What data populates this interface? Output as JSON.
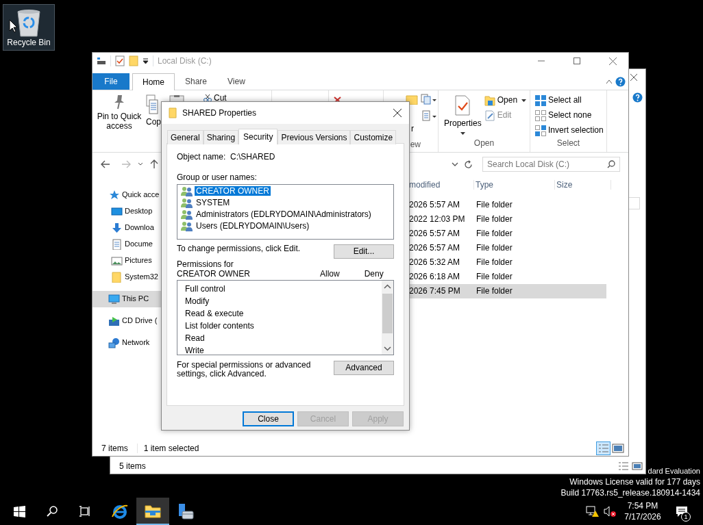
{
  "desktop": {
    "icons": [
      {
        "label": "Recycle Bin",
        "selected": true
      }
    ],
    "license_lines": [
      "dard Evaluation",
      "Windows License valid for 177 days",
      "Build 17763.rs5_release.180914-1434"
    ]
  },
  "back_window": {
    "status": "5 items"
  },
  "explorer": {
    "title": "Local Disk (C:)",
    "ribbon_tabs": [
      {
        "label": "File",
        "kind": "file",
        "selected": false
      },
      {
        "label": "Home",
        "kind": "tab",
        "selected": true
      },
      {
        "label": "Share",
        "kind": "tab",
        "selected": false
      },
      {
        "label": "View",
        "kind": "tab",
        "selected": false
      }
    ],
    "clipboard": {
      "pin": "Pin to Quick access",
      "copy": "Cop",
      "cut": "Cut"
    },
    "new_group": {
      "item": "r",
      "label": "ew"
    },
    "open_group": {
      "label": "Open",
      "properties": "Properties",
      "open": "Open",
      "edit": {
        "label": "Edit",
        "disabled": true
      }
    },
    "select_group": {
      "label": "Select",
      "items": [
        "Select all",
        "Select none",
        "Invert selection"
      ]
    },
    "search": {
      "placeholder": "Search Local Disk (C:)"
    },
    "nav": [
      {
        "label": "Quick acce",
        "kind": "star",
        "selected": false,
        "children": [
          {
            "label": "Desktop",
            "kind": "desktop",
            "selected": false
          },
          {
            "label": "Downloa",
            "kind": "download",
            "selected": false
          },
          {
            "label": "Docume",
            "kind": "documents",
            "selected": false
          },
          {
            "label": "Pictures",
            "kind": "pictures",
            "selected": false
          },
          {
            "label": "System32",
            "kind": "folder",
            "selected": false
          }
        ]
      },
      {
        "label": "This PC",
        "kind": "pc",
        "selected": true
      },
      {
        "label": "CD Drive (",
        "kind": "cd",
        "selected": false
      },
      {
        "label": "Network",
        "kind": "network",
        "selected": false
      }
    ],
    "columns": [
      "modified",
      "Type",
      "Size"
    ],
    "rows": [
      {
        "modified": "2026 5:57 AM",
        "type": "File folder",
        "selected": false
      },
      {
        "modified": "2022 12:03 PM",
        "type": "File folder",
        "selected": false
      },
      {
        "modified": "2026 5:57 AM",
        "type": "File folder",
        "selected": false
      },
      {
        "modified": "2026 5:57 AM",
        "type": "File folder",
        "selected": false
      },
      {
        "modified": "2026 5:32 AM",
        "type": "File folder",
        "selected": false
      },
      {
        "modified": "2026 6:18 AM",
        "type": "File folder",
        "selected": false
      },
      {
        "modified": "2026 7:45 PM",
        "type": "File folder",
        "selected": true
      }
    ],
    "status": {
      "count": "7 items",
      "selection": "1 item selected"
    },
    "views": [
      {
        "kind": "details",
        "selected": true
      },
      {
        "kind": "tiles",
        "selected": false
      }
    ]
  },
  "dialog": {
    "title": "SHARED Properties",
    "tabs": [
      {
        "label": "General",
        "selected": false
      },
      {
        "label": "Sharing",
        "selected": false
      },
      {
        "label": "Security",
        "selected": true
      },
      {
        "label": "Previous Versions",
        "selected": false
      },
      {
        "label": "Customize",
        "selected": false
      }
    ],
    "object_label": "Object name:",
    "object_value": "C:\\SHARED",
    "groups_label": "Group or user names:",
    "users": [
      {
        "name": "CREATOR OWNER",
        "selected": true
      },
      {
        "name": "SYSTEM",
        "selected": false
      },
      {
        "name": "Administrators (EDLRYDOMAIN\\Administrators)",
        "selected": false
      },
      {
        "name": "Users (EDLRYDOMAIN\\Users)",
        "selected": false
      }
    ],
    "change_hint": "To change permissions, click Edit.",
    "edit_button": "Edit...",
    "permissions_label": "Permissions for CREATOR OWNER",
    "allow": "Allow",
    "deny": "Deny",
    "permissions": [
      "Full control",
      "Modify",
      "Read & execute",
      "List folder contents",
      "Read",
      "Write"
    ],
    "advanced_hint": "For special permissions or advanced settings, click Advanced.",
    "advanced_button": "Advanced",
    "buttons": [
      {
        "label": "Close",
        "disabled": false,
        "default": true
      },
      {
        "label": "Cancel",
        "disabled": true,
        "default": false
      },
      {
        "label": "Apply",
        "disabled": true,
        "default": false
      }
    ]
  },
  "taskbar": {
    "apps": [
      {
        "kind": "ie",
        "active": false
      },
      {
        "kind": "explorer",
        "active": true
      },
      {
        "kind": "server",
        "active": false
      }
    ],
    "time": "7:54 PM",
    "date": "7/17/2026",
    "notifications": "1"
  }
}
